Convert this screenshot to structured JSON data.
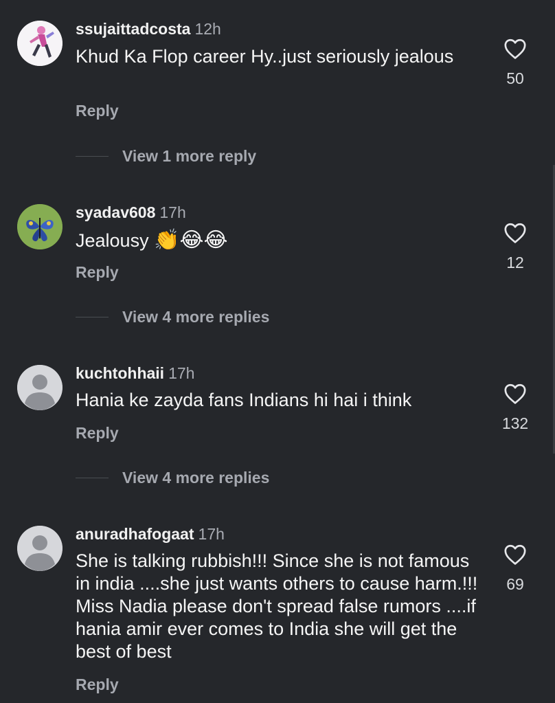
{
  "comments": [
    {
      "username": "ssujaittadcosta",
      "time": "12h",
      "text": "Khud Ka Flop career Hy..just seriously jealous",
      "likes": "50",
      "reply_label": "Reply",
      "view_more": "View 1 more reply",
      "avatar": "pink-figure-avatar"
    },
    {
      "username": "syadav608",
      "time": "17h",
      "text": "Jealousy",
      "emojis": "👏😂😂",
      "likes": "12",
      "reply_label": "Reply",
      "view_more": "View 4 more replies",
      "avatar": "butterfly-avatar"
    },
    {
      "username": "kuchtohhaii",
      "time": "17h",
      "text": "Hania ke zayda fans Indians hi hai i think",
      "likes": "132",
      "reply_label": "Reply",
      "view_more": "View 4 more replies",
      "avatar": "default-avatar"
    },
    {
      "username": "anuradhafogaat",
      "time": "17h",
      "text": "She is talking rubbish!!! Since she is not famous in india ....she just wants others to cause harm.!!! Miss Nadia please don't spread false rumors ....if hania amir ever comes to India she will get the best of best",
      "likes": "69",
      "reply_label": "Reply",
      "avatar": "default-avatar"
    }
  ],
  "colors": {
    "background": "#25272b",
    "secondary_text": "#a6a9b0"
  },
  "icons": {
    "like": "heart-icon"
  }
}
